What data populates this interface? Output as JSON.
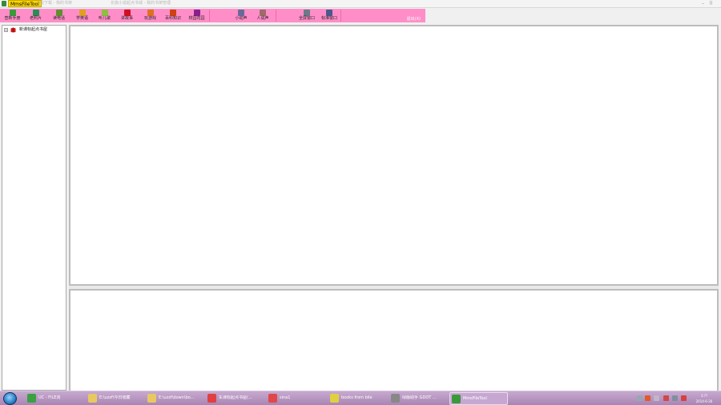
{
  "window": {
    "title": "MmsFileTool",
    "background_titles": [
      "小说下载 - 我的书架",
      "长篇小说起点书城 - 我的书架管理"
    ]
  },
  "toolbar": {
    "buttons": [
      {
        "label": "查新手册",
        "icon": "book-icon",
        "color": "#3a9a3a"
      },
      {
        "label": "老照片",
        "icon": "photo-icon",
        "color": "#2e8b57"
      },
      {
        "label": "读电话",
        "icon": "phone-icon",
        "color": "#5f8f2f"
      },
      {
        "label": "学英语",
        "icon": "english-icon",
        "color": "#e0a020"
      },
      {
        "label": "听儿歌",
        "icon": "music-icon",
        "color": "#8fbf3f"
      },
      {
        "label": "讲故事",
        "icon": "story-icon",
        "color": "#d01020"
      },
      {
        "label": "玩游戏",
        "icon": "game-icon",
        "color": "#e07020"
      },
      {
        "label": "百科知识",
        "icon": "encyclopedia-icon",
        "color": "#d04010"
      },
      {
        "label": "校园花园",
        "icon": "garden-icon",
        "color": "#8a2090"
      },
      {
        "label": "小动声",
        "icon": "animal-icon",
        "color": "#6a6a9a"
      },
      {
        "label": "人说声",
        "icon": "voice-icon",
        "color": "#a06a6a"
      },
      {
        "label": "全屏窗口",
        "icon": "fullscreen-icon",
        "color": "#6a7a8a"
      },
      {
        "label": "标准窗口",
        "icon": "window-icon",
        "color": "#4a5a8a"
      }
    ],
    "status": "退出(X)"
  },
  "tree": {
    "root_label": "新课标起点书屋",
    "expander": "+"
  },
  "taskbar": {
    "tasks": [
      {
        "label": "UC - FILE浏",
        "icon": "browser-icon",
        "color": "#3aa040"
      },
      {
        "label": "E:\\uzzf\\今日收藏",
        "icon": "folder-icon",
        "color": "#e8c860"
      },
      {
        "label": "E:\\uzzf\\down\\bo...",
        "icon": "folder-icon",
        "color": "#e8c860"
      },
      {
        "label": "车课标起点书屋(...",
        "icon": "chrome-icon",
        "color": "#e04040"
      },
      {
        "label": "sina1",
        "icon": "red-circle-icon",
        "color": "#e04848"
      },
      {
        "label": "books from bile",
        "icon": "yellow-app-icon",
        "color": "#e0d040"
      },
      {
        "label": "绿版助手 GDOT ...",
        "icon": "inkscape-icon",
        "color": "#888888"
      },
      {
        "label": "MmsFileTool",
        "icon": "app-icon",
        "color": "#3a9a3a",
        "active": true
      }
    ],
    "clock_time": "3:??",
    "clock_date": "2014-6-26"
  },
  "colors": {
    "toolbar": "#ff8ec8",
    "taskbar": "#b895c2",
    "title_highlight": "#ffd800"
  }
}
